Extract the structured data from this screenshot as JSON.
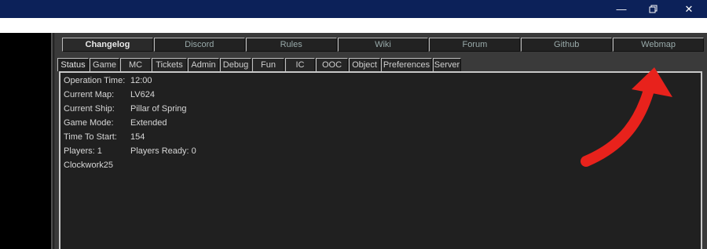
{
  "window": {
    "minimize_glyph": "—",
    "maximize_icon": "restore-icon",
    "close_glyph": "✕"
  },
  "links": [
    {
      "label": "Changelog"
    },
    {
      "label": "Discord"
    },
    {
      "label": "Rules"
    },
    {
      "label": "Wiki"
    },
    {
      "label": "Forum"
    },
    {
      "label": "Github"
    },
    {
      "label": "Webmap"
    }
  ],
  "tabs": [
    {
      "label": "Status"
    },
    {
      "label": "Game"
    },
    {
      "label": "MC"
    },
    {
      "label": "Tickets"
    },
    {
      "label": "Admin"
    },
    {
      "label": "Debug"
    },
    {
      "label": "Fun"
    },
    {
      "label": "IC"
    },
    {
      "label": "OOC"
    },
    {
      "label": "Object"
    },
    {
      "label": "Preferences"
    },
    {
      "label": "Server"
    }
  ],
  "status": {
    "operation_time_label": "Operation Time:",
    "operation_time_value": "12:00",
    "current_map_label": "Current Map:",
    "current_map_value": "LV624",
    "current_ship_label": "Current Ship:",
    "current_ship_value": "Pillar of Spring",
    "game_mode_label": "Game Mode:",
    "game_mode_value": "Extended",
    "time_to_start_label": "Time To Start:",
    "time_to_start_value": "154",
    "players_label": "Players: 1",
    "players_ready_label": "Players Ready: 0",
    "player_name": "Clockwork25"
  },
  "colors": {
    "titlebar": "#0c2159",
    "arrow": "#e8221c"
  }
}
